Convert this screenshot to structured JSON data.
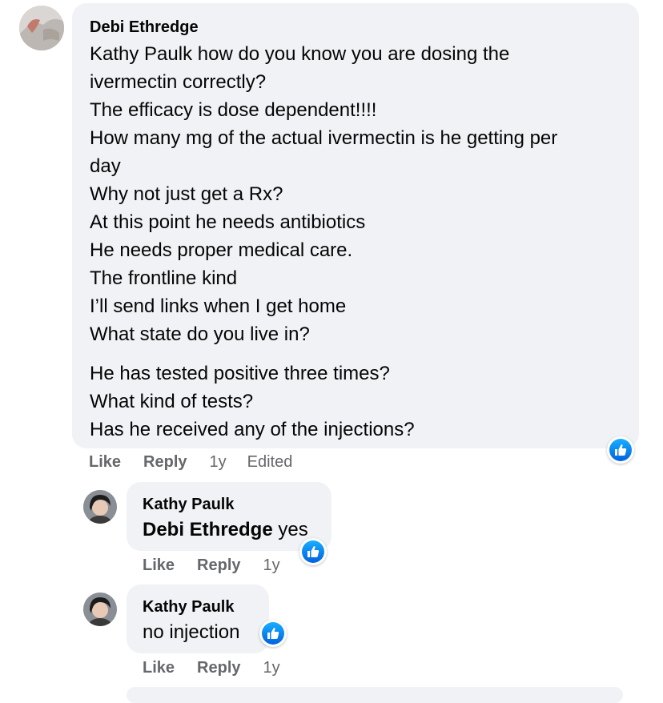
{
  "comments": [
    {
      "author": "Debi Ethredge",
      "lines": [
        "Kathy Paulk how do you know you are dosing the",
        "ivermectin correctly?",
        "The efficacy is dose dependent!!!!",
        "How many mg of the actual ivermectin is he getting per",
        "day",
        "Why not just get a Rx?",
        "At this point he needs antibiotics",
        "He needs proper medical care.",
        "The frontline kind",
        "I’ll send links when I get home",
        "What state do you live in?"
      ],
      "lines2": [
        "He has tested positive three times?",
        "What kind of tests?",
        "Has he received any of the injections?"
      ],
      "like": "Like",
      "reply": "Reply",
      "time": "1y",
      "edited": "Edited",
      "reaction": "like-icon"
    },
    {
      "author": "Kathy Paulk",
      "mention": "Debi Ethredge",
      "text": " yes",
      "like": "Like",
      "reply": "Reply",
      "time": "1y",
      "reaction": "like-icon"
    },
    {
      "author": "Kathy Paulk",
      "text": "no injection",
      "like": "Like",
      "reply": "Reply",
      "time": "1y",
      "reaction": "like-icon"
    }
  ],
  "colors": {
    "bubble": "#f0f2f5",
    "meta_text": "#65676b",
    "like_blue": "#0866ff"
  }
}
